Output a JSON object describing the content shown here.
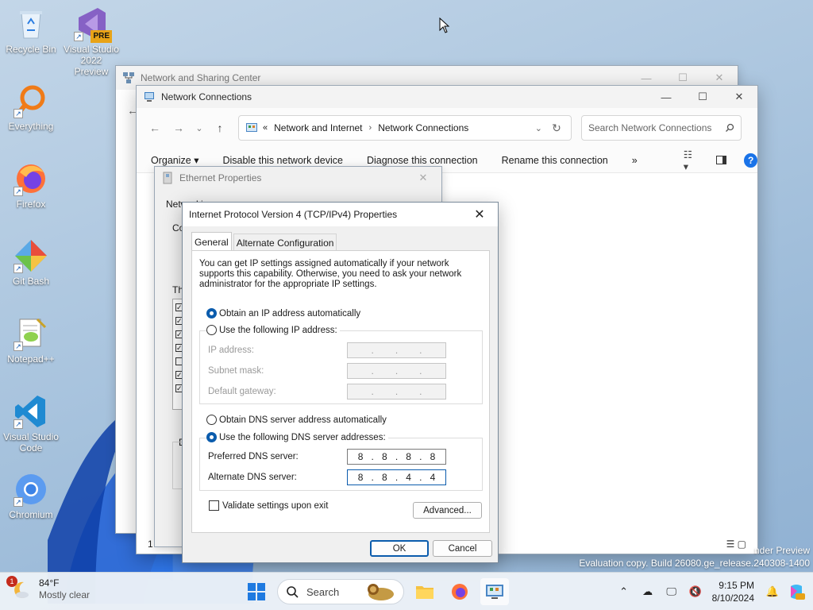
{
  "desktop": {
    "icons": [
      {
        "label": "Recycle Bin",
        "icon": "recycle-bin-icon"
      },
      {
        "label": "Visual Studio 2022 Preview",
        "icon": "visual-studio-icon",
        "badge": "PRE"
      },
      {
        "label": "Everything",
        "icon": "everything-icon"
      },
      {
        "label": "Firefox",
        "icon": "firefox-icon"
      },
      {
        "label": "Git Bash",
        "icon": "git-bash-icon"
      },
      {
        "label": "Notepad++",
        "icon": "notepadpp-icon"
      },
      {
        "label": "Visual Studio Code",
        "icon": "vscode-icon"
      },
      {
        "label": "Chromium",
        "icon": "chromium-icon"
      }
    ],
    "watermark": {
      "line1": "nder Preview",
      "line2": "Evaluation copy. Build 26080.ge_release.240308-1400"
    }
  },
  "network_sharing_center": {
    "title": "Network and Sharing Center"
  },
  "network_connections": {
    "title": "Network Connections",
    "breadcrumb": {
      "prefix": "«",
      "items": [
        "Network and Internet",
        "Network Connections"
      ]
    },
    "search_placeholder": "Search Network Connections",
    "commands": [
      "Organize ▾",
      "Disable this network device",
      "Diagnose this connection",
      "Rename this connection",
      "»"
    ],
    "status": "1 item"
  },
  "ethernet_properties": {
    "title": "Ethernet Properties",
    "fragments": {
      "networking": "Networking",
      "connect": "Co",
      "this": "Th",
      "desc": "D"
    }
  },
  "ipv4_dialog": {
    "title": "Internet Protocol Version 4 (TCP/IPv4) Properties",
    "tabs": [
      "General",
      "Alternate Configuration"
    ],
    "intro": "You can get IP settings assigned automatically if your network supports this capability. Otherwise, you need to ask your network administrator for the appropriate IP settings.",
    "ip_auto": "Obtain an IP address automatically",
    "ip_manual": "Use the following IP address:",
    "ip_fields": [
      {
        "label": "IP address:",
        "octets": [
          "",
          "",
          "",
          ""
        ]
      },
      {
        "label": "Subnet mask:",
        "octets": [
          "",
          "",
          "",
          ""
        ]
      },
      {
        "label": "Default gateway:",
        "octets": [
          "",
          "",
          "",
          ""
        ]
      }
    ],
    "dns_auto": "Obtain DNS server address automatically",
    "dns_manual": "Use the following DNS server addresses:",
    "dns_fields": [
      {
        "label": "Preferred DNS server:",
        "octets": [
          "8",
          "8",
          "8",
          "8"
        ]
      },
      {
        "label": "Alternate DNS server:",
        "octets": [
          "8",
          "8",
          "4",
          "4"
        ]
      }
    ],
    "validate": "Validate settings upon exit",
    "advanced": "Advanced...",
    "ok": "OK",
    "cancel": "Cancel"
  },
  "taskbar": {
    "weather": {
      "temp": "84°F",
      "condition": "Mostly clear",
      "alert": "1"
    },
    "search": "Search",
    "clock": {
      "time": "9:15 PM",
      "date": "8/10/2024"
    }
  }
}
